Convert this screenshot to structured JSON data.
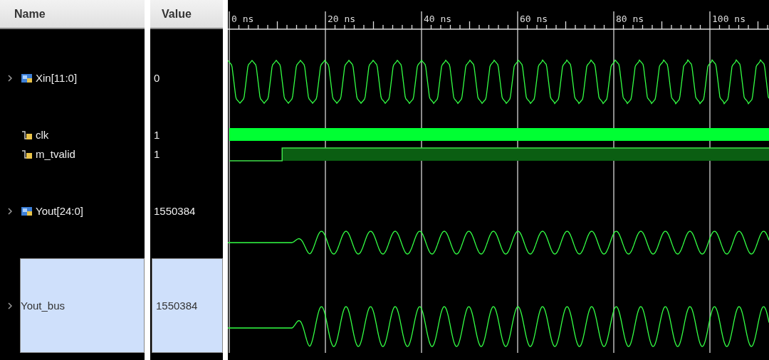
{
  "columns": {
    "name": "Name",
    "value": "Value"
  },
  "timeline": [
    "0 ns",
    "20 ns",
    "40 ns",
    "60 ns",
    "80 ns",
    "100 ns"
  ],
  "signals": [
    {
      "name": "Xin[11:0]",
      "value": "0",
      "kind": "bus",
      "waveform": {
        "kind": "triangle"
      },
      "expandable": true,
      "selected": false
    },
    {
      "name": "clk",
      "value": "1",
      "kind": "bit",
      "waveform": {
        "kind": "clock"
      },
      "expandable": false,
      "selected": false
    },
    {
      "name": "m_tvalid",
      "value": "1",
      "kind": "bit",
      "waveform": {
        "kind": "step"
      },
      "expandable": false,
      "selected": false
    },
    {
      "name": "Yout[24:0]",
      "value": "1550384",
      "kind": "bus",
      "waveform": {
        "kind": "sine_small"
      },
      "expandable": true,
      "selected": false
    },
    {
      "name": "Yout_bus",
      "value": "1550384",
      "kind": "virtual_bus",
      "waveform": {
        "kind": "sine_large"
      },
      "expandable": true,
      "selected": true
    }
  ]
}
